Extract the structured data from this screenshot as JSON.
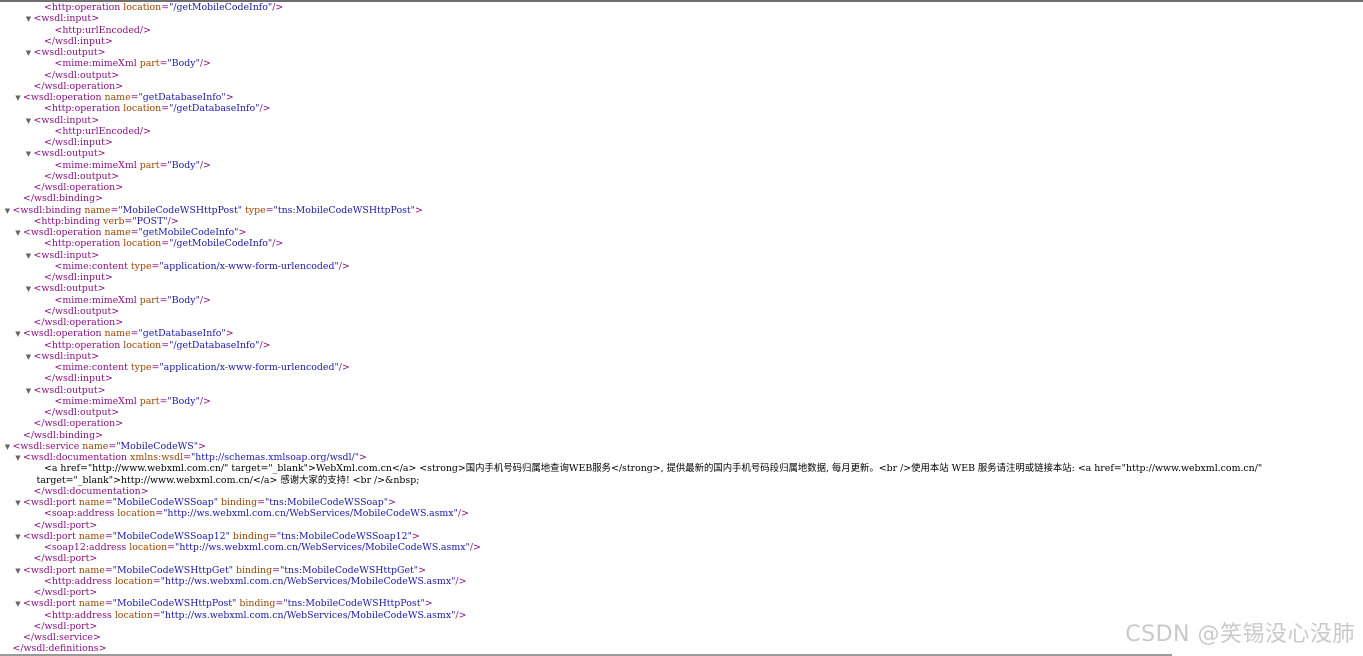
{
  "lines": [
    {
      "indent": 4,
      "toggle": false,
      "parts": [
        [
          "tag",
          "<http:operation "
        ],
        [
          "an",
          "location"
        ],
        [
          "tag",
          "="
        ],
        [
          "av",
          "\"/getMobileCodeInfo\""
        ],
        [
          "tag",
          "/>"
        ]
      ]
    },
    {
      "indent": 3,
      "toggle": true,
      "parts": [
        [
          "tag",
          "<wsdl:input>"
        ]
      ]
    },
    {
      "indent": 5,
      "toggle": false,
      "parts": [
        [
          "tag",
          "<http:urlEncoded/>"
        ]
      ]
    },
    {
      "indent": 4,
      "toggle": false,
      "parts": [
        [
          "tag",
          "</wsdl:input>"
        ]
      ]
    },
    {
      "indent": 3,
      "toggle": true,
      "parts": [
        [
          "tag",
          "<wsdl:output>"
        ]
      ]
    },
    {
      "indent": 5,
      "toggle": false,
      "parts": [
        [
          "tag",
          "<mime:mimeXml "
        ],
        [
          "an",
          "part"
        ],
        [
          "tag",
          "="
        ],
        [
          "av",
          "\"Body\""
        ],
        [
          "tag",
          "/>"
        ]
      ]
    },
    {
      "indent": 4,
      "toggle": false,
      "parts": [
        [
          "tag",
          "</wsdl:output>"
        ]
      ]
    },
    {
      "indent": 3,
      "toggle": false,
      "parts": [
        [
          "tag",
          "</wsdl:operation>"
        ]
      ]
    },
    {
      "indent": 2,
      "toggle": true,
      "parts": [
        [
          "tag",
          "<wsdl:operation "
        ],
        [
          "an",
          "name"
        ],
        [
          "tag",
          "="
        ],
        [
          "av",
          "\"getDatabaseInfo\""
        ],
        [
          "tag",
          ">"
        ]
      ]
    },
    {
      "indent": 4,
      "toggle": false,
      "parts": [
        [
          "tag",
          "<http:operation "
        ],
        [
          "an",
          "location"
        ],
        [
          "tag",
          "="
        ],
        [
          "av",
          "\"/getDatabaseInfo\""
        ],
        [
          "tag",
          "/>"
        ]
      ]
    },
    {
      "indent": 3,
      "toggle": true,
      "parts": [
        [
          "tag",
          "<wsdl:input>"
        ]
      ]
    },
    {
      "indent": 5,
      "toggle": false,
      "parts": [
        [
          "tag",
          "<http:urlEncoded/>"
        ]
      ]
    },
    {
      "indent": 4,
      "toggle": false,
      "parts": [
        [
          "tag",
          "</wsdl:input>"
        ]
      ]
    },
    {
      "indent": 3,
      "toggle": true,
      "parts": [
        [
          "tag",
          "<wsdl:output>"
        ]
      ]
    },
    {
      "indent": 5,
      "toggle": false,
      "parts": [
        [
          "tag",
          "<mime:mimeXml "
        ],
        [
          "an",
          "part"
        ],
        [
          "tag",
          "="
        ],
        [
          "av",
          "\"Body\""
        ],
        [
          "tag",
          "/>"
        ]
      ]
    },
    {
      "indent": 4,
      "toggle": false,
      "parts": [
        [
          "tag",
          "</wsdl:output>"
        ]
      ]
    },
    {
      "indent": 3,
      "toggle": false,
      "parts": [
        [
          "tag",
          "</wsdl:operation>"
        ]
      ]
    },
    {
      "indent": 2,
      "toggle": false,
      "parts": [
        [
          "tag",
          "</wsdl:binding>"
        ]
      ]
    },
    {
      "indent": 1,
      "toggle": true,
      "parts": [
        [
          "tag",
          "<wsdl:binding "
        ],
        [
          "an",
          "name"
        ],
        [
          "tag",
          "="
        ],
        [
          "av",
          "\"MobileCodeWSHttpPost\""
        ],
        [
          "tag",
          " "
        ],
        [
          "an",
          "type"
        ],
        [
          "tag",
          "="
        ],
        [
          "av",
          "\"tns:MobileCodeWSHttpPost\""
        ],
        [
          "tag",
          ">"
        ]
      ]
    },
    {
      "indent": 3,
      "toggle": false,
      "parts": [
        [
          "tag",
          "<http:binding "
        ],
        [
          "an",
          "verb"
        ],
        [
          "tag",
          "="
        ],
        [
          "av",
          "\"POST\""
        ],
        [
          "tag",
          "/>"
        ]
      ]
    },
    {
      "indent": 2,
      "toggle": true,
      "parts": [
        [
          "tag",
          "<wsdl:operation "
        ],
        [
          "an",
          "name"
        ],
        [
          "tag",
          "="
        ],
        [
          "av",
          "\"getMobileCodeInfo\""
        ],
        [
          "tag",
          ">"
        ]
      ]
    },
    {
      "indent": 4,
      "toggle": false,
      "parts": [
        [
          "tag",
          "<http:operation "
        ],
        [
          "an",
          "location"
        ],
        [
          "tag",
          "="
        ],
        [
          "av",
          "\"/getMobileCodeInfo\""
        ],
        [
          "tag",
          "/>"
        ]
      ]
    },
    {
      "indent": 3,
      "toggle": true,
      "parts": [
        [
          "tag",
          "<wsdl:input>"
        ]
      ]
    },
    {
      "indent": 5,
      "toggle": false,
      "parts": [
        [
          "tag",
          "<mime:content "
        ],
        [
          "an",
          "type"
        ],
        [
          "tag",
          "="
        ],
        [
          "av",
          "\"application/x-www-form-urlencoded\""
        ],
        [
          "tag",
          "/>"
        ]
      ]
    },
    {
      "indent": 4,
      "toggle": false,
      "parts": [
        [
          "tag",
          "</wsdl:input>"
        ]
      ]
    },
    {
      "indent": 3,
      "toggle": true,
      "parts": [
        [
          "tag",
          "<wsdl:output>"
        ]
      ]
    },
    {
      "indent": 5,
      "toggle": false,
      "parts": [
        [
          "tag",
          "<mime:mimeXml "
        ],
        [
          "an",
          "part"
        ],
        [
          "tag",
          "="
        ],
        [
          "av",
          "\"Body\""
        ],
        [
          "tag",
          "/>"
        ]
      ]
    },
    {
      "indent": 4,
      "toggle": false,
      "parts": [
        [
          "tag",
          "</wsdl:output>"
        ]
      ]
    },
    {
      "indent": 3,
      "toggle": false,
      "parts": [
        [
          "tag",
          "</wsdl:operation>"
        ]
      ]
    },
    {
      "indent": 2,
      "toggle": true,
      "parts": [
        [
          "tag",
          "<wsdl:operation "
        ],
        [
          "an",
          "name"
        ],
        [
          "tag",
          "="
        ],
        [
          "av",
          "\"getDatabaseInfo\""
        ],
        [
          "tag",
          ">"
        ]
      ]
    },
    {
      "indent": 4,
      "toggle": false,
      "parts": [
        [
          "tag",
          "<http:operation "
        ],
        [
          "an",
          "location"
        ],
        [
          "tag",
          "="
        ],
        [
          "av",
          "\"/getDatabaseInfo\""
        ],
        [
          "tag",
          "/>"
        ]
      ]
    },
    {
      "indent": 3,
      "toggle": true,
      "parts": [
        [
          "tag",
          "<wsdl:input>"
        ]
      ]
    },
    {
      "indent": 5,
      "toggle": false,
      "parts": [
        [
          "tag",
          "<mime:content "
        ],
        [
          "an",
          "type"
        ],
        [
          "tag",
          "="
        ],
        [
          "av",
          "\"application/x-www-form-urlencoded\""
        ],
        [
          "tag",
          "/>"
        ]
      ]
    },
    {
      "indent": 4,
      "toggle": false,
      "parts": [
        [
          "tag",
          "</wsdl:input>"
        ]
      ]
    },
    {
      "indent": 3,
      "toggle": true,
      "parts": [
        [
          "tag",
          "<wsdl:output>"
        ]
      ]
    },
    {
      "indent": 5,
      "toggle": false,
      "parts": [
        [
          "tag",
          "<mime:mimeXml "
        ],
        [
          "an",
          "part"
        ],
        [
          "tag",
          "="
        ],
        [
          "av",
          "\"Body\""
        ],
        [
          "tag",
          "/>"
        ]
      ]
    },
    {
      "indent": 4,
      "toggle": false,
      "parts": [
        [
          "tag",
          "</wsdl:output>"
        ]
      ]
    },
    {
      "indent": 3,
      "toggle": false,
      "parts": [
        [
          "tag",
          "</wsdl:operation>"
        ]
      ]
    },
    {
      "indent": 2,
      "toggle": false,
      "parts": [
        [
          "tag",
          "</wsdl:binding>"
        ]
      ]
    },
    {
      "indent": 1,
      "toggle": true,
      "parts": [
        [
          "tag",
          "<wsdl:service "
        ],
        [
          "an",
          "name"
        ],
        [
          "tag",
          "="
        ],
        [
          "av",
          "\"MobileCodeWS\""
        ],
        [
          "tag",
          ">"
        ]
      ]
    },
    {
      "indent": 2,
      "toggle": true,
      "parts": [
        [
          "tag",
          "<wsdl:documentation "
        ],
        [
          "an",
          "xmlns:wsdl"
        ],
        [
          "tag",
          "="
        ],
        [
          "av",
          "\"http://schemas.xmlsoap.org/wsdl/\""
        ],
        [
          "tag",
          ">"
        ]
      ]
    },
    {
      "indent": 4,
      "toggle": false,
      "parts": [
        [
          "tx",
          "<a href=\"http://www.webxml.com.cn/\" target=\"_blank\">WebXml.com.cn</a> <strong>国内手机号码归属地查询WEB服务</strong>, 提供最新的国内手机号码段归属地数据, 每月更新。<br />使用本站 WEB 服务请注明或链接本站: <a href=\"http://www.webxml.com.cn/\""
        ]
      ]
    },
    {
      "indent": 3,
      "toggle": false,
      "parts": [
        [
          "tx",
          " target=\"_blank\">http://www.webxml.com.cn/</a> 感谢大家的支持! <br />&nbsp;"
        ]
      ]
    },
    {
      "indent": 3,
      "toggle": false,
      "parts": [
        [
          "tag",
          "</wsdl:documentation>"
        ]
      ]
    },
    {
      "indent": 2,
      "toggle": true,
      "parts": [
        [
          "tag",
          "<wsdl:port "
        ],
        [
          "an",
          "name"
        ],
        [
          "tag",
          "="
        ],
        [
          "av",
          "\"MobileCodeWSSoap\""
        ],
        [
          "tag",
          " "
        ],
        [
          "an",
          "binding"
        ],
        [
          "tag",
          "="
        ],
        [
          "av",
          "\"tns:MobileCodeWSSoap\""
        ],
        [
          "tag",
          ">"
        ]
      ]
    },
    {
      "indent": 4,
      "toggle": false,
      "parts": [
        [
          "tag",
          "<soap:address "
        ],
        [
          "an",
          "location"
        ],
        [
          "tag",
          "="
        ],
        [
          "av",
          "\"http://ws.webxml.com.cn/WebServices/MobileCodeWS.asmx\""
        ],
        [
          "tag",
          "/>"
        ]
      ]
    },
    {
      "indent": 3,
      "toggle": false,
      "parts": [
        [
          "tag",
          "</wsdl:port>"
        ]
      ]
    },
    {
      "indent": 2,
      "toggle": true,
      "parts": [
        [
          "tag",
          "<wsdl:port "
        ],
        [
          "an",
          "name"
        ],
        [
          "tag",
          "="
        ],
        [
          "av",
          "\"MobileCodeWSSoap12\""
        ],
        [
          "tag",
          " "
        ],
        [
          "an",
          "binding"
        ],
        [
          "tag",
          "="
        ],
        [
          "av",
          "\"tns:MobileCodeWSSoap12\""
        ],
        [
          "tag",
          ">"
        ]
      ]
    },
    {
      "indent": 4,
      "toggle": false,
      "parts": [
        [
          "tag",
          "<soap12:address "
        ],
        [
          "an",
          "location"
        ],
        [
          "tag",
          "="
        ],
        [
          "av",
          "\"http://ws.webxml.com.cn/WebServices/MobileCodeWS.asmx\""
        ],
        [
          "tag",
          "/>"
        ]
      ]
    },
    {
      "indent": 3,
      "toggle": false,
      "parts": [
        [
          "tag",
          "</wsdl:port>"
        ]
      ]
    },
    {
      "indent": 2,
      "toggle": true,
      "parts": [
        [
          "tag",
          "<wsdl:port "
        ],
        [
          "an",
          "name"
        ],
        [
          "tag",
          "="
        ],
        [
          "av",
          "\"MobileCodeWSHttpGet\""
        ],
        [
          "tag",
          " "
        ],
        [
          "an",
          "binding"
        ],
        [
          "tag",
          "="
        ],
        [
          "av",
          "\"tns:MobileCodeWSHttpGet\""
        ],
        [
          "tag",
          ">"
        ]
      ]
    },
    {
      "indent": 4,
      "toggle": false,
      "parts": [
        [
          "tag",
          "<http:address "
        ],
        [
          "an",
          "location"
        ],
        [
          "tag",
          "="
        ],
        [
          "av",
          "\"http://ws.webxml.com.cn/WebServices/MobileCodeWS.asmx\""
        ],
        [
          "tag",
          "/>"
        ]
      ]
    },
    {
      "indent": 3,
      "toggle": false,
      "parts": [
        [
          "tag",
          "</wsdl:port>"
        ]
      ]
    },
    {
      "indent": 2,
      "toggle": true,
      "parts": [
        [
          "tag",
          "<wsdl:port "
        ],
        [
          "an",
          "name"
        ],
        [
          "tag",
          "="
        ],
        [
          "av",
          "\"MobileCodeWSHttpPost\""
        ],
        [
          "tag",
          " "
        ],
        [
          "an",
          "binding"
        ],
        [
          "tag",
          "="
        ],
        [
          "av",
          "\"tns:MobileCodeWSHttpPost\""
        ],
        [
          "tag",
          ">"
        ]
      ]
    },
    {
      "indent": 4,
      "toggle": false,
      "parts": [
        [
          "tag",
          "<http:address "
        ],
        [
          "an",
          "location"
        ],
        [
          "tag",
          "="
        ],
        [
          "av",
          "\"http://ws.webxml.com.cn/WebServices/MobileCodeWS.asmx\""
        ],
        [
          "tag",
          "/>"
        ]
      ]
    },
    {
      "indent": 3,
      "toggle": false,
      "parts": [
        [
          "tag",
          "</wsdl:port>"
        ]
      ]
    },
    {
      "indent": 2,
      "toggle": false,
      "parts": [
        [
          "tag",
          "</wsdl:service>"
        ]
      ]
    },
    {
      "indent": 1,
      "toggle": false,
      "parts": [
        [
          "tag",
          "</wsdl:definitions>"
        ]
      ]
    }
  ],
  "toggle_glyph": "▼",
  "watermark": "CSDN @笑锡没心没肺"
}
